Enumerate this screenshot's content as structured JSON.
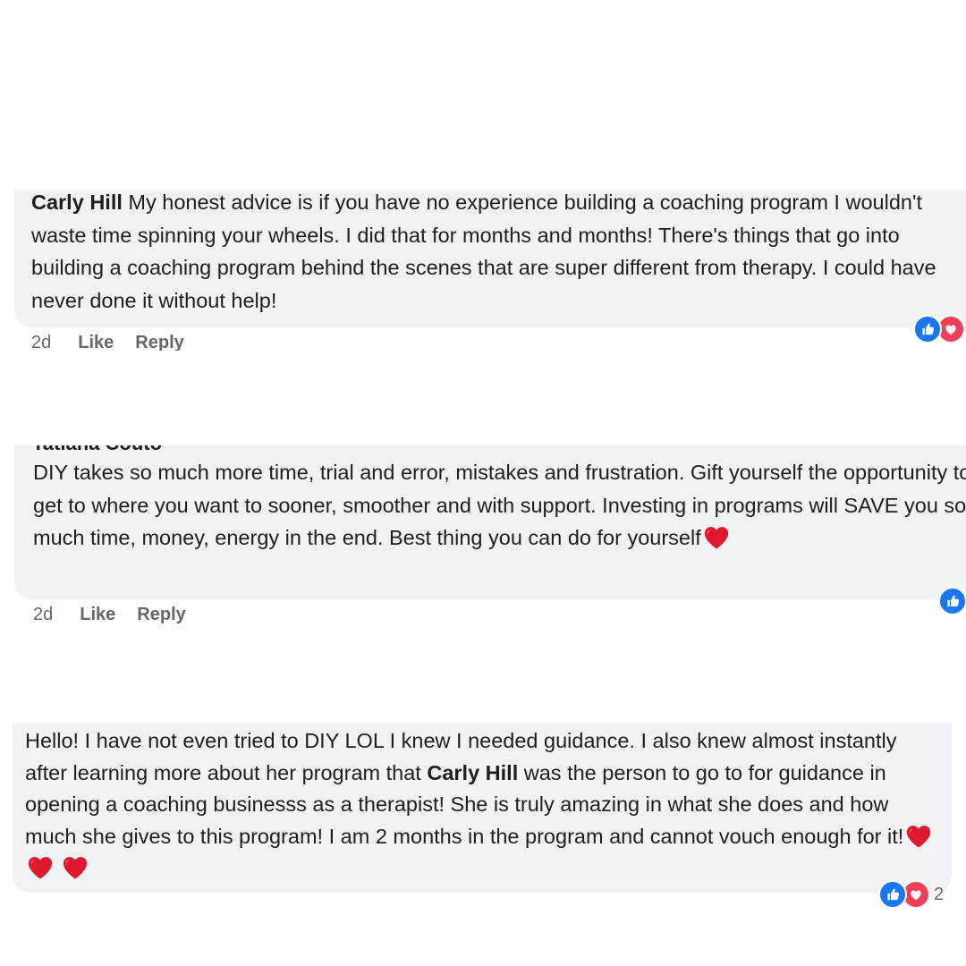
{
  "comments": [
    {
      "author": "Carly Hill",
      "text": "My honest advice is if you have no experience building a coaching program I wouldn't waste time spinning your wheels. I did that for months and months! There's things that go into building a coaching program behind the scenes that are super different from therapy. I could have never done it without help!",
      "time": "2d",
      "like_label": "Like",
      "reply_label": "Reply",
      "reactions": [
        "like-icon",
        "love-icon"
      ]
    },
    {
      "author": "Tatiana Couto",
      "text": "DIY takes so much more time, trial and error, mistakes and frustration. Gift yourself the opportunity to get to where you want to sooner, smoother and with support. Investing in programs will SAVE you so much time, money, energy in the end. Best thing you can do for yourself",
      "time": "2d",
      "like_label": "Like",
      "reply_label": "Reply",
      "reactions": [
        "like-icon"
      ]
    },
    {
      "text_before": "Hello! I have not even tried to DIY LOL I knew I needed guidance. I also knew almost instantly after learning more about her program that",
      "mention": "Carly Hill",
      "text_after": "was the person to go to for guidance in opening a coaching businesss as a therapist! She is truly amazing in what she does and how much she gives to this program! I am 2 months in the program and cannot vouch enough for it!",
      "reactions": [
        "like-icon",
        "love-icon"
      ],
      "reaction_count": "2"
    }
  ],
  "colors": {
    "bubble": "#f0f2f5",
    "text": "#1c1e21",
    "meta": "#65676b",
    "like": "#1877f2",
    "love": "#f33e58",
    "heart": "#e0182d"
  }
}
